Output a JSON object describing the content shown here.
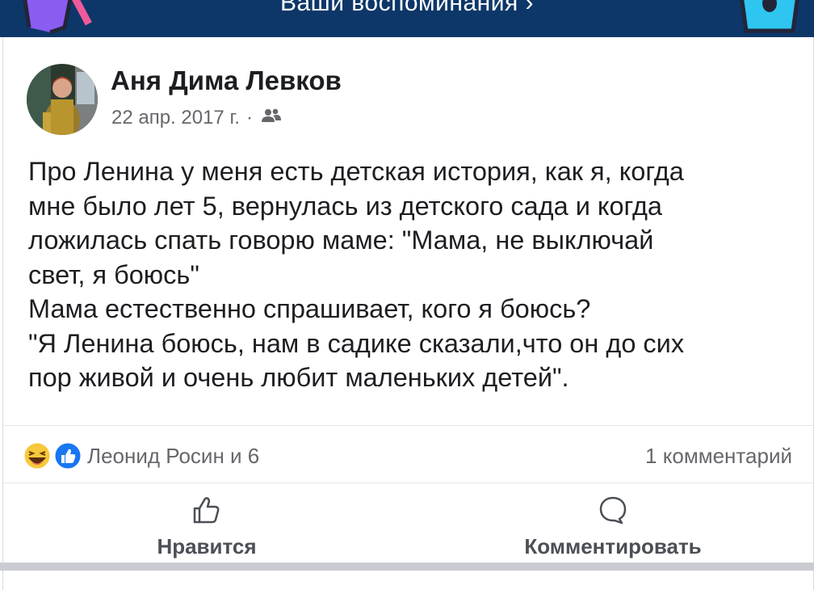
{
  "banner": {
    "text": "Ваши воспоминания ›"
  },
  "post": {
    "author": "Аня Дима Левков",
    "date": "22 апр. 2017 г.",
    "separator": "·",
    "audience_icon": "friends-icon",
    "paragraphs": [
      "Про Ленина у меня есть детская история, как я, когда",
      "мне было лет 5, вернулась из детского сада и когда",
      "ложилась спать говорю маме: \"Мама, не выключай",
      "свет, я боюсь\"",
      "Мама естественно спрашивает, кого я боюсь?",
      "\"Я Ленина боюсь, нам в садике сказали,что он до сих",
      "пор живой и очень любит маленьких детей\"."
    ]
  },
  "reactions": {
    "icons": [
      "haha-icon",
      "like-icon"
    ],
    "people": "Леонид Росин и 6",
    "comments": "1 комментарий"
  },
  "actions": {
    "like_label": "Нравится",
    "comment_label": "Комментировать"
  },
  "colors": {
    "banner_bg": "#0d3768",
    "like_blue": "#1877f2",
    "haha_yellow": "#f7c83a",
    "secondary_text": "#65676b"
  }
}
